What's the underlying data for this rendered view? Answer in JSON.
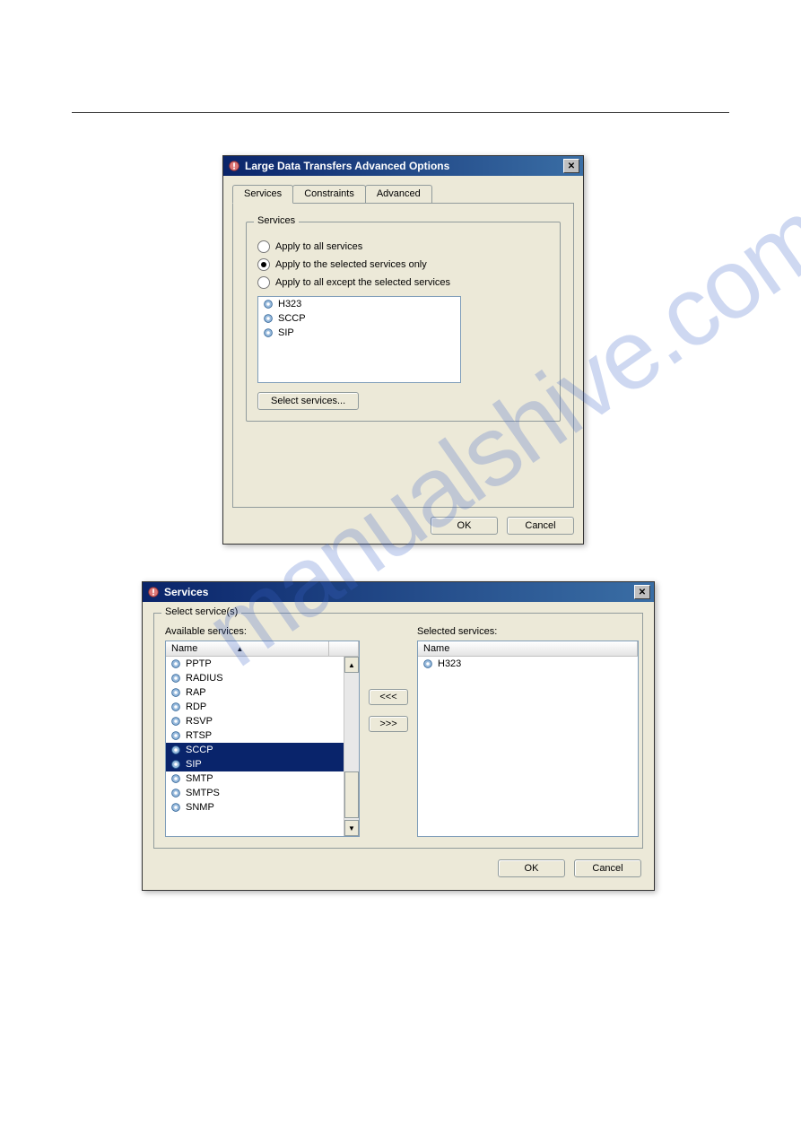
{
  "dialog1": {
    "title": "Large Data Transfers Advanced Options",
    "tabs": [
      "Services",
      "Constraints",
      "Advanced"
    ],
    "active_tab": 0,
    "services_group": {
      "legend": "Services",
      "radios": [
        {
          "label": "Apply to all services",
          "checked": false
        },
        {
          "label": "Apply to the selected services only",
          "checked": true
        },
        {
          "label": "Apply to all except the selected services",
          "checked": false
        }
      ],
      "list": [
        "H323",
        "SCCP",
        "SIP"
      ],
      "select_btn": "Select services..."
    },
    "ok": "OK",
    "cancel": "Cancel"
  },
  "dialog2": {
    "title": "Services",
    "group_legend": "Select service(s)",
    "available_label": "Available services:",
    "selected_label": "Selected services:",
    "name_header": "Name",
    "available": [
      {
        "label": "PPTP",
        "sel": false
      },
      {
        "label": "RADIUS",
        "sel": false
      },
      {
        "label": "RAP",
        "sel": false
      },
      {
        "label": "RDP",
        "sel": false
      },
      {
        "label": "RSVP",
        "sel": false
      },
      {
        "label": "RTSP",
        "sel": false
      },
      {
        "label": "SCCP",
        "sel": true
      },
      {
        "label": "SIP",
        "sel": true
      },
      {
        "label": "SMTP",
        "sel": false
      },
      {
        "label": "SMTPS",
        "sel": false
      },
      {
        "label": "SNMP",
        "sel": false
      }
    ],
    "selected": [
      "H323"
    ],
    "remove_btn": "<<<",
    "add_btn": ">>>",
    "ok": "OK",
    "cancel": "Cancel"
  }
}
